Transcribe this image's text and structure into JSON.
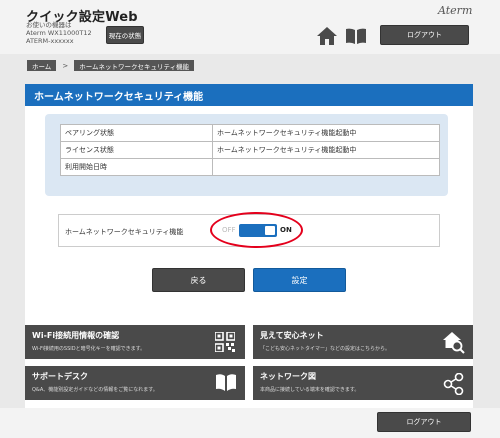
{
  "header": {
    "app_title": "クイック設定Web",
    "device_label": "お使いの機器は",
    "device_model": "Aterm WX11000T12",
    "device_id": "ATERM-xxxxxx",
    "status_button": "現在の状態",
    "brand": "Aterm",
    "logout_label": "ログアウト"
  },
  "breadcrumb": {
    "items": [
      "ホーム",
      "ホームネットワークセキュリティ機能"
    ],
    "separator": ">"
  },
  "page_title": "ホームネットワークセキュリティ機能",
  "info_table": {
    "rows": [
      {
        "label": "ペアリング状態",
        "value": "ホームネットワークセキュリティ機能起動中"
      },
      {
        "label": "ライセンス状態",
        "value": "ホームネットワークセキュリティ機能起動中"
      },
      {
        "label": "利用開始日時",
        "value": ""
      }
    ]
  },
  "setting": {
    "label": "ホームネットワークセキュリティ機能",
    "off_label": "OFF",
    "on_label": "ON",
    "state": "ON"
  },
  "actions": {
    "back_label": "戻る",
    "submit_label": "設定"
  },
  "tiles": [
    {
      "title": "Wi-Fi接続用情報の確認",
      "desc": "Wi-Fi接続用のSSIDと暗号化キーを確認できます。",
      "icon": "qr-code-icon"
    },
    {
      "title": "見えて安心ネット",
      "desc": "「こども安心ネットタイマー」などの設定はこちらから。",
      "icon": "home-search-icon"
    },
    {
      "title": "サポートデスク",
      "desc": "Q&A、機能別設定ガイドなどの情報をご覧になれます。",
      "icon": "book-icon"
    },
    {
      "title": "ネットワーク図",
      "desc": "本商品に接続している端末を確認できます。",
      "icon": "network-icon"
    }
  ],
  "footer": {
    "logout_label": "ログアウト"
  },
  "colors": {
    "accent": "#1b6fbe",
    "dark_button": "#4a4a4a",
    "highlight": "#e4001c",
    "info_bg": "#dbe7f3"
  }
}
